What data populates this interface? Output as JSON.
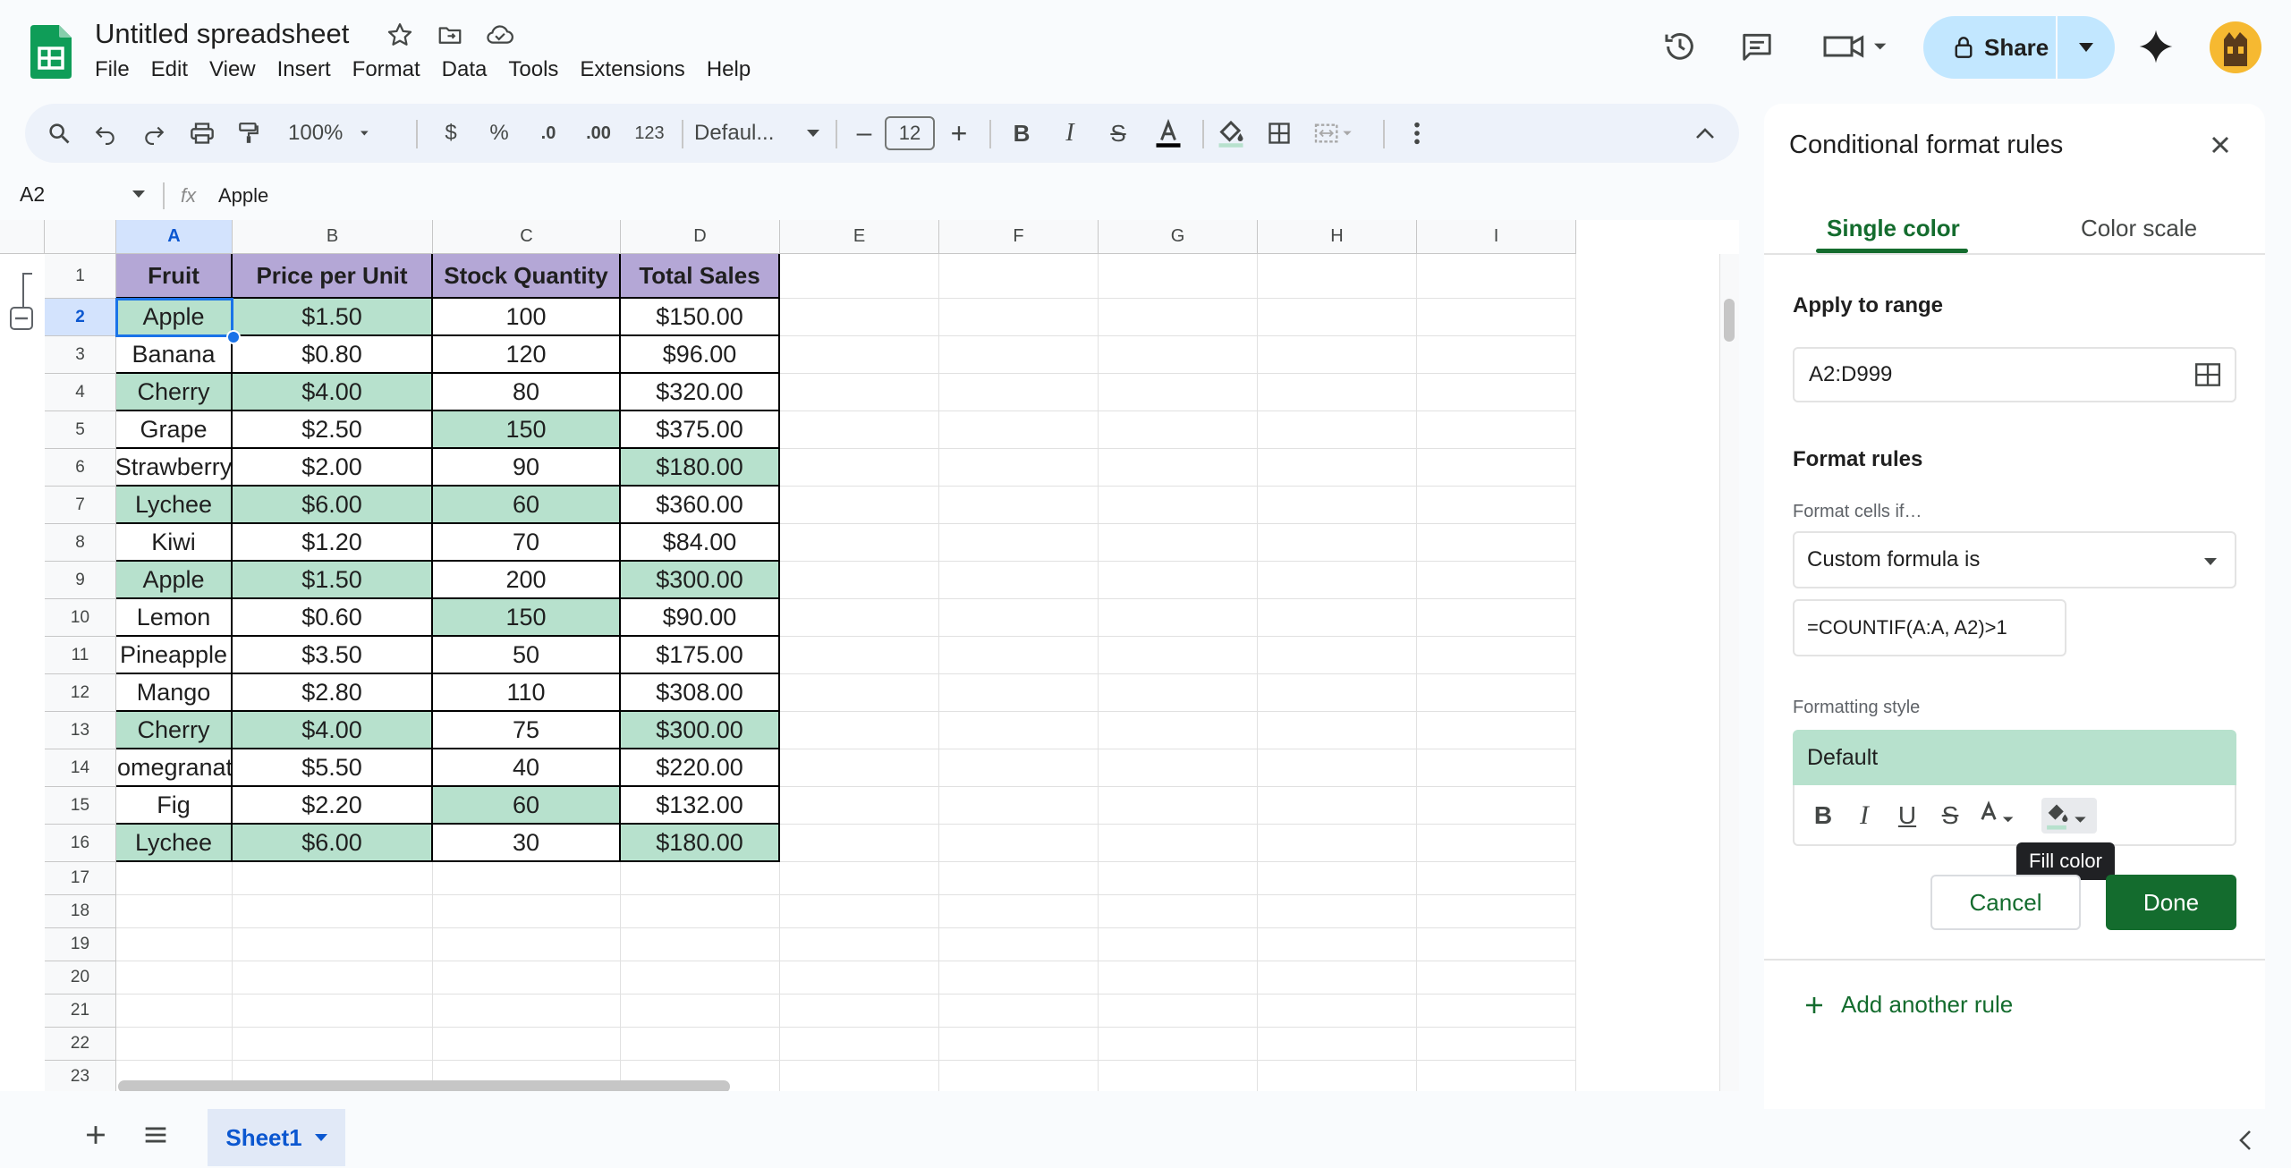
{
  "app": {
    "title": "Untitled spreadsheet",
    "menus": [
      "File",
      "Edit",
      "View",
      "Insert",
      "Format",
      "Data",
      "Tools",
      "Extensions",
      "Help"
    ],
    "share_label": "Share"
  },
  "toolbar": {
    "zoom": "100%",
    "currency": "$",
    "percent": "%",
    "dec_decrease": ".0",
    "dec_increase": ".00",
    "number_format": "123",
    "font": "Defaul...",
    "font_size": "12",
    "minus": "–",
    "plus": "+"
  },
  "formula_bar": {
    "name_box": "A2",
    "fx": "fx",
    "value": "Apple"
  },
  "grid": {
    "columns": [
      "A",
      "B",
      "C",
      "D",
      "E",
      "F",
      "G",
      "H",
      "I"
    ],
    "rows": [
      "1",
      "2",
      "3",
      "4",
      "5",
      "6",
      "7",
      "8",
      "9",
      "10",
      "11",
      "12",
      "13",
      "14",
      "15",
      "16",
      "17",
      "18",
      "19",
      "20",
      "21",
      "22",
      "23"
    ],
    "header": [
      "Fruit",
      "Price per Unit",
      "Stock Quantity",
      "Total Sales"
    ],
    "data": [
      [
        "Apple",
        "$1.50",
        "100",
        "$150.00"
      ],
      [
        "Banana",
        "$0.80",
        "120",
        "$96.00"
      ],
      [
        "Cherry",
        "$4.00",
        "80",
        "$320.00"
      ],
      [
        "Grape",
        "$2.50",
        "150",
        "$375.00"
      ],
      [
        "Strawberry",
        "$2.00",
        "90",
        "$180.00"
      ],
      [
        "Lychee",
        "$6.00",
        "60",
        "$360.00"
      ],
      [
        "Kiwi",
        "$1.20",
        "70",
        "$84.00"
      ],
      [
        "Apple",
        "$1.50",
        "200",
        "$300.00"
      ],
      [
        "Lemon",
        "$0.60",
        "150",
        "$90.00"
      ],
      [
        "Pineapple",
        "$3.50",
        "50",
        "$175.00"
      ],
      [
        "Mango",
        "$2.80",
        "110",
        "$308.00"
      ],
      [
        "Cherry",
        "$4.00",
        "75",
        "$300.00"
      ],
      [
        "Pomegranate",
        "$5.50",
        "40",
        "$220.00"
      ],
      [
        "Fig",
        "$2.20",
        "60",
        "$132.00"
      ],
      [
        "Lychee",
        "$6.00",
        "30",
        "$180.00"
      ]
    ],
    "highlighted": [
      [
        true,
        true,
        false,
        false
      ],
      [
        false,
        false,
        false,
        false
      ],
      [
        true,
        true,
        false,
        false
      ],
      [
        false,
        false,
        true,
        false
      ],
      [
        false,
        false,
        false,
        true
      ],
      [
        true,
        true,
        true,
        false
      ],
      [
        false,
        false,
        false,
        false
      ],
      [
        true,
        true,
        false,
        true
      ],
      [
        false,
        false,
        true,
        false
      ],
      [
        false,
        false,
        false,
        false
      ],
      [
        false,
        false,
        false,
        false
      ],
      [
        true,
        true,
        false,
        true
      ],
      [
        false,
        false,
        false,
        false
      ],
      [
        false,
        false,
        true,
        false
      ],
      [
        true,
        true,
        false,
        true
      ]
    ],
    "header_color": "#b4a7d6",
    "highlight_color": "#b7e1cd"
  },
  "sheet_tab": "Sheet1",
  "panel": {
    "title": "Conditional format rules",
    "tab_single": "Single color",
    "tab_scale": "Color scale",
    "apply_label": "Apply to range",
    "range": "A2:D999",
    "format_rules_label": "Format rules",
    "format_if_label": "Format cells if…",
    "condition": "Custom formula is",
    "formula": "=COUNTIF(A:A, A2)>1",
    "style_label": "Formatting style",
    "style_preview": "Default",
    "tooltip": "Fill color",
    "cancel": "Cancel",
    "done": "Done",
    "add_rule": "Add another rule"
  },
  "accent_color": "#146c2e"
}
